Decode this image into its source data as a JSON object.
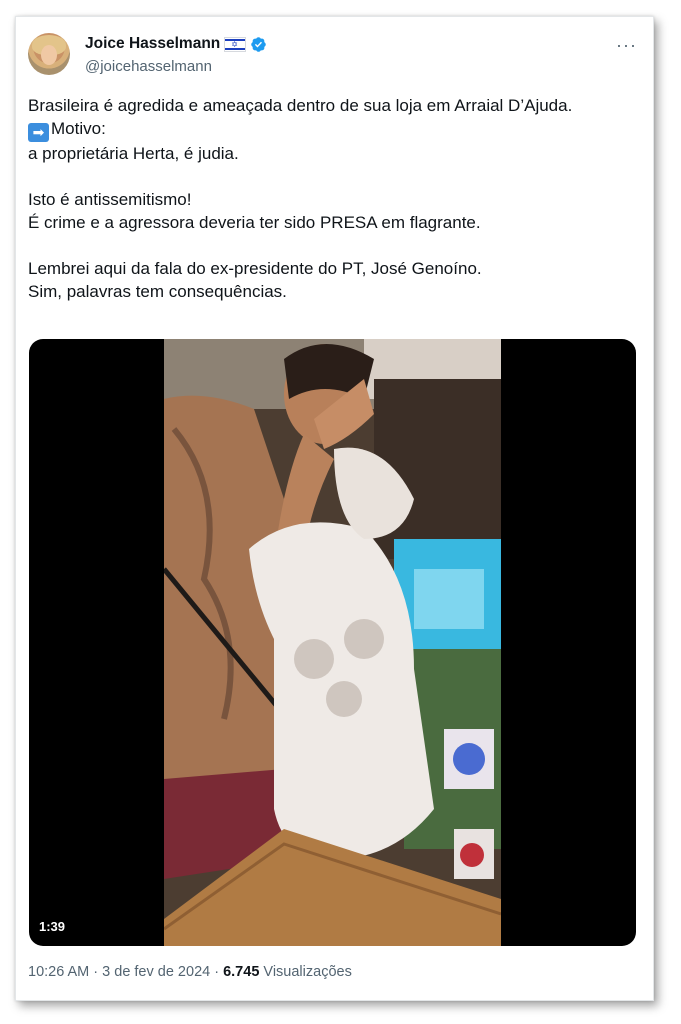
{
  "tweet": {
    "author_name": "Joice Hasselmann",
    "author_handle": "@joicehasselmann",
    "more_label": "···",
    "text_line1": "Brasileira é agredida e ameaçada dentro de sua loja em Arraial D’Ajuda.",
    "text_line2": "Motivo:",
    "text_line3": "a proprietária Herta, é judia.",
    "text_line4": "Isto é antissemitismo!",
    "text_line5": "É crime e a agressora deveria ter sido PRESA em flagrante.",
    "text_line6": "Lembrei aqui da fala do ex-presidente do PT, José Genoíno.",
    "text_line7": "Sim, palavras tem consequências.",
    "arrow_emoji": "➡",
    "video_duration": "1:39",
    "time": "10:26 AM",
    "date": "3 de fev de 2024",
    "views_count": "6.745",
    "views_label": "Visualizações"
  },
  "colors": {
    "verified": "#1d9bf0",
    "secondary_text": "#536471",
    "primary_text": "#0f1419"
  },
  "icons": [
    "israel-flag-icon",
    "verified-badge-icon",
    "more-options-icon",
    "right-arrow-emoji-icon"
  ]
}
